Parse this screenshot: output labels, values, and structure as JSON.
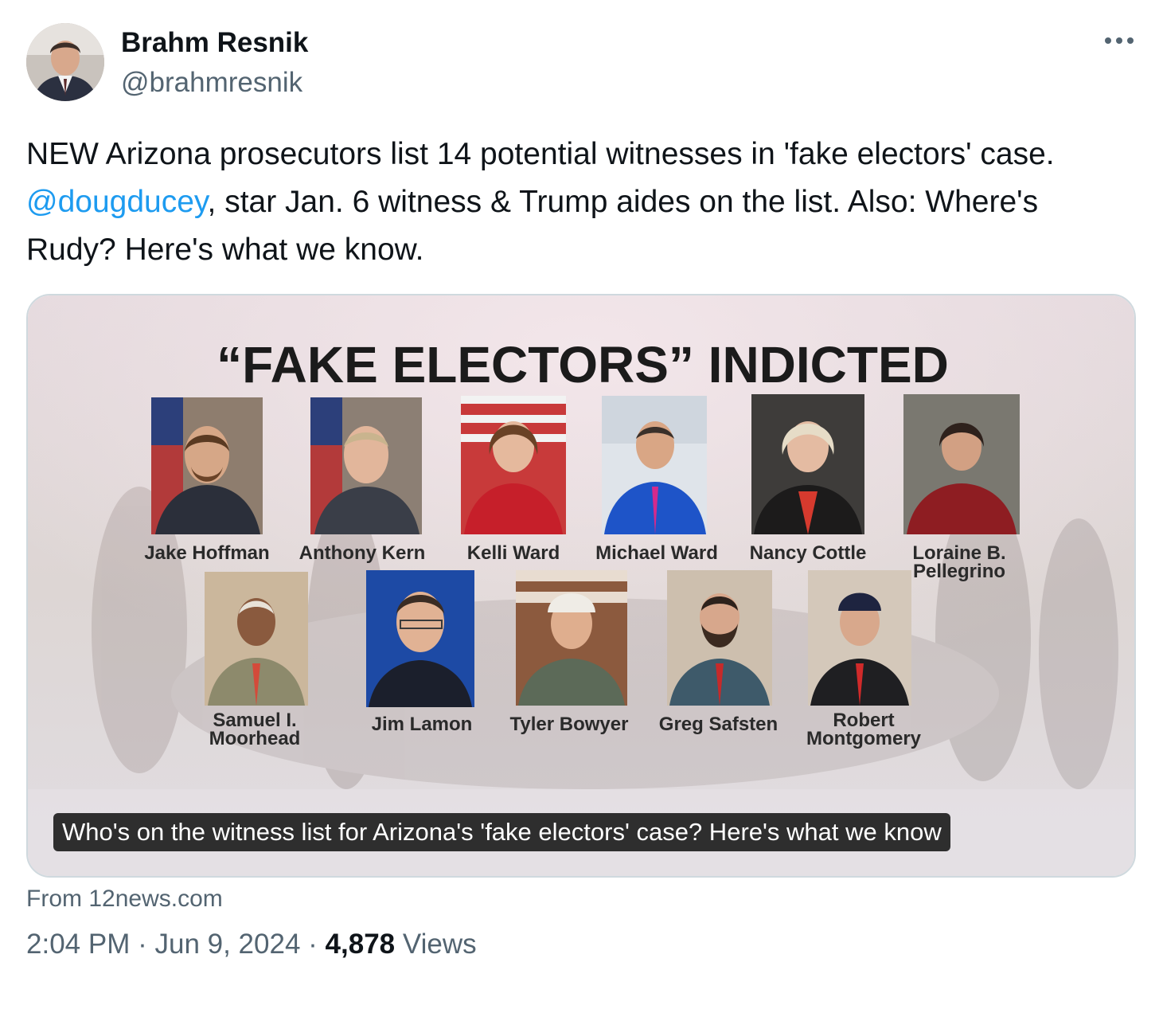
{
  "author": {
    "name": "Brahm Resnik",
    "handle": "@brahmresnik"
  },
  "tweet": {
    "text_part1": "NEW Arizona prosecutors list 14 potential witnesses in 'fake electors' case. ",
    "mention": "@dougducey",
    "text_part2": ", star Jan. 6 witness & Trump aides on the list. Also: Where's Rudy? Here's what we know."
  },
  "card": {
    "headline": "“FAKE ELECTORS” INDICTED",
    "people_row1": [
      "Jake Hoffman",
      "Anthony Kern",
      "Kelli Ward",
      "Michael Ward",
      "Nancy Cottle",
      "Loraine B. Pellegrino"
    ],
    "people_row2": [
      "Samuel I. Moorhead",
      "Jim Lamon",
      "Tyler Bowyer",
      "Greg Safsten",
      "Robert Montgomery"
    ],
    "caption": "Who's on the witness list for Arizona's 'fake electors' case? Here's what we know",
    "source": "From 12news.com"
  },
  "meta": {
    "time": "2:04 PM",
    "sep1": "·",
    "date": "Jun 9, 2024",
    "sep2": "·",
    "views_count": "4,878",
    "views_label": "Views"
  },
  "icons": {
    "more": "more-horizontal-icon",
    "avatar": "author-avatar"
  },
  "colors": {
    "link": "#1d9bf0",
    "secondary_text": "#536471",
    "primary_text": "#0f1419",
    "border": "#cfd9de"
  }
}
